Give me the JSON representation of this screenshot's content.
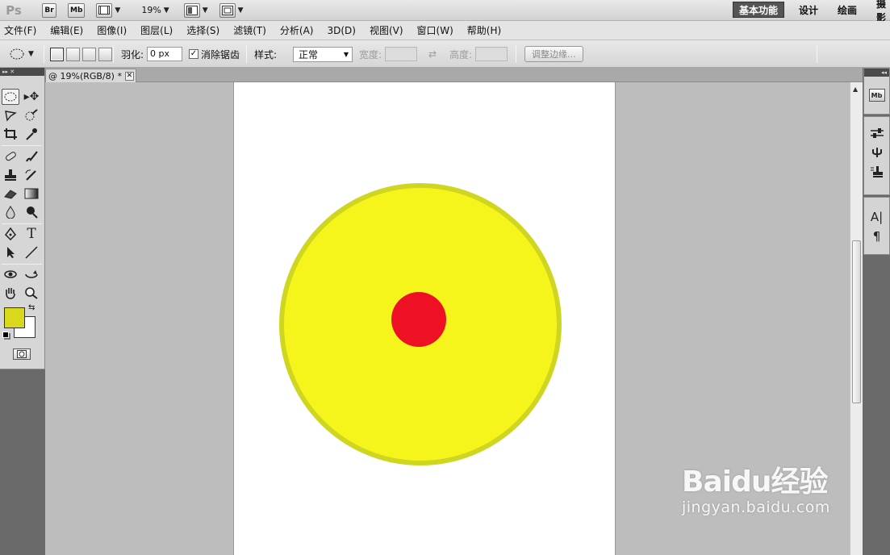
{
  "app": {
    "logo": "Ps",
    "bridge": "Br",
    "minibridge": "Mb",
    "zoom": "19%",
    "workspaces": {
      "essentials": "基本功能",
      "design": "设计",
      "painting": "绘画",
      "photography": "摄影"
    }
  },
  "menu": [
    "文件(F)",
    "编辑(E)",
    "图像(I)",
    "图层(L)",
    "选择(S)",
    "滤镜(T)",
    "分析(A)",
    "3D(D)",
    "视图(V)",
    "窗口(W)",
    "帮助(H)"
  ],
  "options": {
    "feather_label": "羽化:",
    "feather_value": "0 px",
    "antialias_label": "消除锯齿",
    "antialias_checked": "✓",
    "style_label": "样式:",
    "style_value": "正常",
    "width_label": "宽度:",
    "height_label": "高度:",
    "swap_glyph": "⇄",
    "refine_edge": "调整边缘..."
  },
  "document": {
    "tab_title": "@ 19%(RGB/8) *",
    "close_glyph": "✕"
  },
  "canvas": {
    "outer_circle_fill": "#f5f51c",
    "outer_circle_stroke": "#cfd620",
    "inner_dot_fill": "#ee1123",
    "page_color": "#ffffff"
  },
  "colors": {
    "foreground": "#d8d81c",
    "background": "#ffffff"
  },
  "toolbox": {
    "panel_glyphs": "▸▸ ✕",
    "tools": [
      "elliptical-marquee-icon",
      "move-icon",
      "lasso-icon",
      "quick-selection-icon",
      "crop-icon",
      "eyedropper-icon",
      "healing-brush-icon",
      "brush-icon",
      "stamp-icon",
      "history-brush-icon",
      "eraser-icon",
      "gradient-icon",
      "blur-icon",
      "dodge-icon",
      "pen-icon",
      "type-icon",
      "path-select-icon",
      "line-icon",
      "3d-rotate-icon",
      "3d-orbit-icon",
      "hand-icon",
      "zoom-icon"
    ]
  },
  "watermark": {
    "logo": "Baidu经验",
    "url": "jingyan.baidu.com"
  }
}
